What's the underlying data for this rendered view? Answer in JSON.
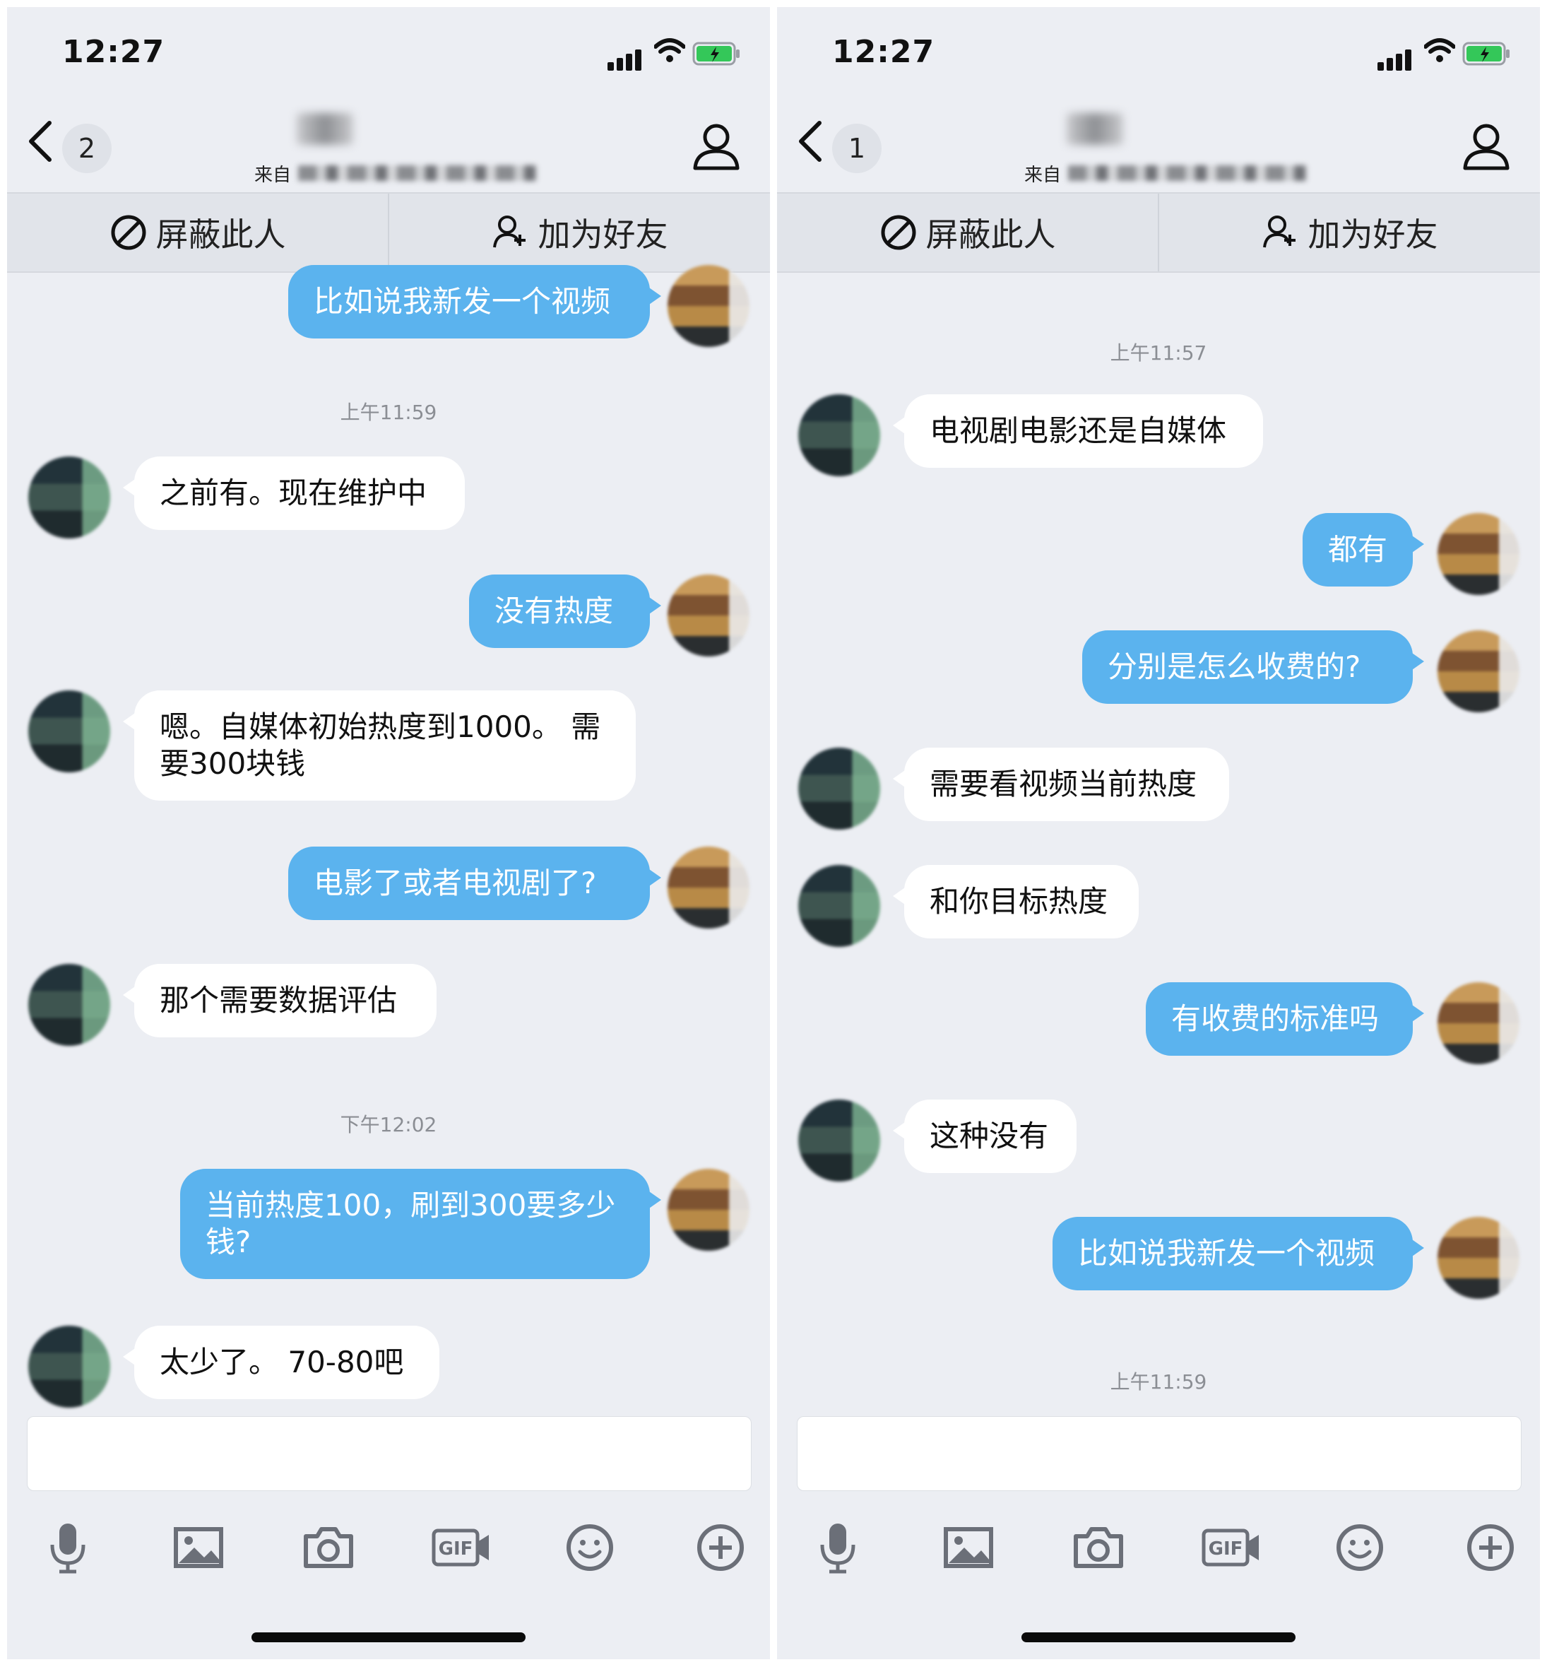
{
  "status": {
    "time": "12:27"
  },
  "left": {
    "nav": {
      "badge": "2",
      "subtitle_prefix": "来自"
    },
    "actions": {
      "block": "屏蔽此人",
      "add_friend": "加为好友"
    },
    "messages": [
      {
        "text": "比如说我新发一个视频"
      },
      {
        "text": "上午11:59"
      },
      {
        "text": "之前有。现在维护中"
      },
      {
        "text": "没有热度"
      },
      {
        "text": "嗯。自媒体初始热度到1000。 需要300块钱"
      },
      {
        "text": "电影了或者电视剧了?"
      },
      {
        "text": "那个需要数据评估"
      },
      {
        "text": "下午12:02"
      },
      {
        "text": "当前热度100，刷到300要多少钱?"
      },
      {
        "text": "太少了。 70-80吧"
      }
    ]
  },
  "right": {
    "nav": {
      "badge": "1",
      "subtitle_prefix": "来自"
    },
    "actions": {
      "block": "屏蔽此人",
      "add_friend": "加为好友"
    },
    "messages": [
      {
        "text": "上午11:57"
      },
      {
        "text": "电视剧电影还是自媒体"
      },
      {
        "text": "都有"
      },
      {
        "text": "分别是怎么收费的?"
      },
      {
        "text": "需要看视频当前热度"
      },
      {
        "text": "和你目标热度"
      },
      {
        "text": "有收费的标准吗"
      },
      {
        "text": "这种没有"
      },
      {
        "text": "比如说我新发一个视频"
      },
      {
        "text": "上午11:59"
      }
    ]
  },
  "toolbar": {
    "icons": [
      "microphone-icon",
      "image-icon",
      "camera-icon",
      "gif-icon",
      "emoji-icon",
      "plus-circle-icon"
    ],
    "gif_label": "GIF"
  },
  "colors": {
    "outgoing_bubble": "#5bb3ee",
    "incoming_bubble": "#ffffff",
    "background": "#eceef3",
    "battery_green": "#34c759"
  }
}
